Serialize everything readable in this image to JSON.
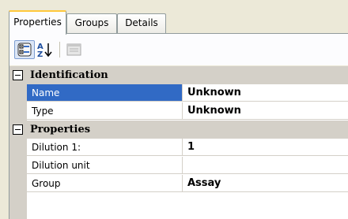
{
  "tabs": [
    {
      "label": "Properties",
      "active": true
    },
    {
      "label": "Groups",
      "active": false
    },
    {
      "label": "Details",
      "active": false
    }
  ],
  "toolbar": {
    "icons": [
      "categorized-view-icon",
      "alphabetical-sort-icon",
      "property-pages-icon"
    ]
  },
  "grid": {
    "categories": [
      {
        "label": "Identification",
        "expanded": true,
        "properties": [
          {
            "name": "Name",
            "value": "Unknown",
            "selected": true
          },
          {
            "name": "Type",
            "value": "Unknown",
            "selected": false
          }
        ]
      },
      {
        "label": "Properties",
        "expanded": true,
        "properties": [
          {
            "name": "Dilution 1:",
            "value": "1",
            "selected": false
          },
          {
            "name": "Dilution unit",
            "value": "",
            "selected": false
          },
          {
            "name": "Group",
            "value": "Assay",
            "selected": false
          }
        ]
      }
    ]
  },
  "colors": {
    "selection": "#316ac5",
    "category_bg": "#d4d0c8",
    "tab_highlight": "#ffc83c"
  }
}
